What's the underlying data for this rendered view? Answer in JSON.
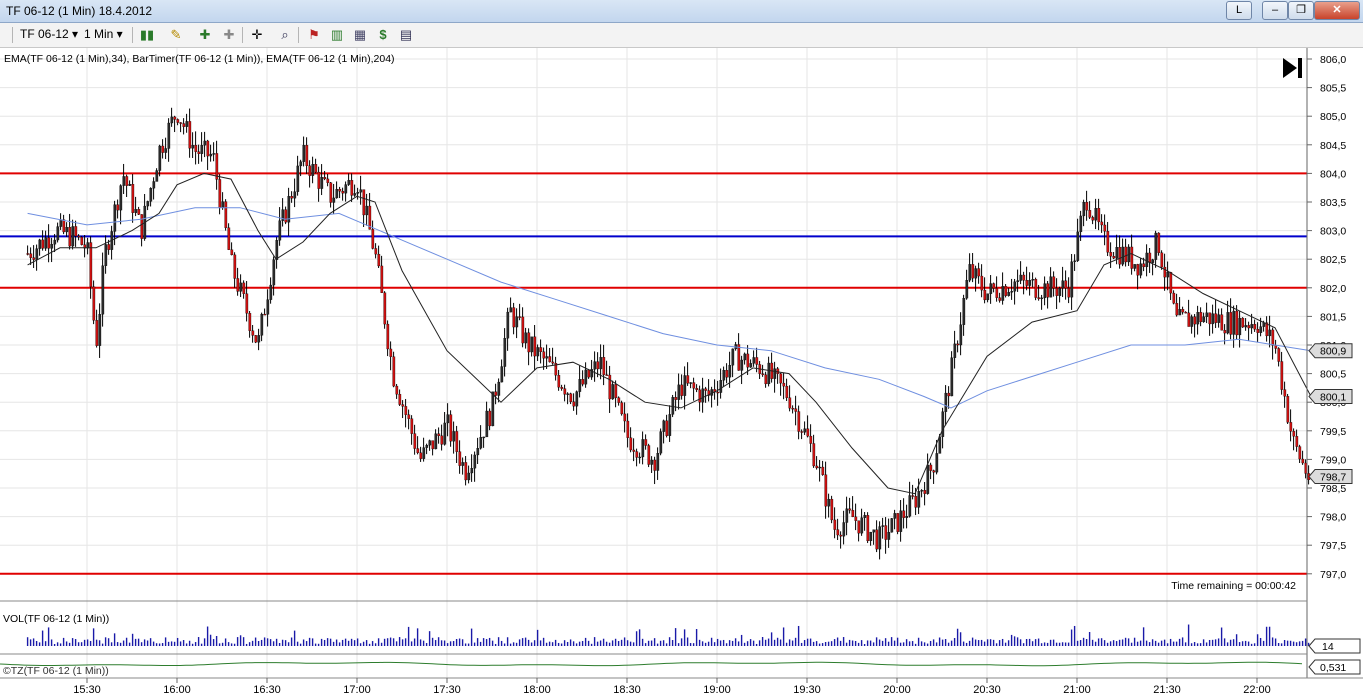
{
  "window": {
    "title": "TF 06-12 (1 Min)  18.4.2012",
    "layout_button": "L",
    "min_label": "–",
    "max_label": "❐",
    "close_label": "✕"
  },
  "toolbar": {
    "instrument": "TF 06-12",
    "interval": "1 Min",
    "icons": [
      "bar-type-icon",
      "drawing-pencil-icon",
      "zoom-in-icon",
      "zoom-out-icon",
      "crosshair-icon",
      "search-icon",
      "strategy-icon",
      "indicator-icon",
      "chart-template-icon",
      "dollar-icon",
      "properties-icon"
    ]
  },
  "indicators_label": "EMA(TF 06-12 (1 Min),34), BarTimer(TF 06-12 (1 Min)), EMA(TF 06-12 (1 Min),204)",
  "time_remaining": "Time remaining = 00:00:42",
  "price_axis_labels": [
    "806,0",
    "805,5",
    "805,0",
    "804,5",
    "804,0",
    "803,5",
    "803,0",
    "802,5",
    "802,0",
    "801,5",
    "801,0",
    "800,5",
    "800,0",
    "799,5",
    "799,0",
    "798,5",
    "798,0",
    "797,5",
    "797,0"
  ],
  "price_markers": [
    "800,9",
    "800,1",
    "798,7"
  ],
  "volume": {
    "label": "VOL(TF 06-12 (1 Min))",
    "marker": "14"
  },
  "lower_panel": {
    "label": "©TZ(TF 06-12 (1 Min))",
    "marker": "0,531"
  },
  "time_labels": [
    "15:30",
    "16:00",
    "16:30",
    "17:00",
    "17:30",
    "18:00",
    "18:30",
    "19:00",
    "19:30",
    "20:00",
    "20:30",
    "21:00",
    "21:30",
    "22:00"
  ],
  "chart_data": {
    "type": "candlestick",
    "yrange": [
      797.0,
      806.0
    ],
    "horizontal_lines": [
      {
        "price": 804.0,
        "color": "#e00000"
      },
      {
        "price": 802.9,
        "color": "#0000cc"
      },
      {
        "price": 802.0,
        "color": "#e00000"
      },
      {
        "price": 797.0,
        "color": "#e00000"
      }
    ],
    "close_path": [
      [
        15.17,
        802.6
      ],
      [
        15.33,
        803.0
      ],
      [
        15.42,
        802.9
      ],
      [
        15.5,
        802.7
      ],
      [
        15.55,
        801.0
      ],
      [
        15.6,
        802.6
      ],
      [
        15.7,
        804.0
      ],
      [
        15.8,
        803.0
      ],
      [
        15.9,
        804.4
      ],
      [
        16.0,
        805.1
      ],
      [
        16.1,
        804.4
      ],
      [
        16.2,
        804.3
      ],
      [
        16.3,
        802.4
      ],
      [
        16.45,
        801.0
      ],
      [
        16.55,
        802.8
      ],
      [
        16.7,
        804.3
      ],
      [
        16.85,
        803.6
      ],
      [
        17.0,
        803.9
      ],
      [
        17.1,
        802.6
      ],
      [
        17.2,
        800.5
      ],
      [
        17.35,
        799.0
      ],
      [
        17.5,
        799.6
      ],
      [
        17.6,
        798.8
      ],
      [
        17.75,
        799.9
      ],
      [
        17.85,
        801.6
      ],
      [
        17.95,
        801.0
      ],
      [
        18.05,
        800.7
      ],
      [
        18.2,
        800.1
      ],
      [
        18.35,
        800.7
      ],
      [
        18.5,
        799.4
      ],
      [
        18.65,
        799.0
      ],
      [
        18.8,
        800.3
      ],
      [
        18.95,
        800.1
      ],
      [
        19.1,
        800.8
      ],
      [
        19.25,
        800.6
      ],
      [
        19.4,
        800.1
      ],
      [
        19.55,
        799.0
      ],
      [
        19.65,
        797.8
      ],
      [
        19.75,
        798.0
      ],
      [
        19.9,
        797.6
      ],
      [
        20.0,
        797.9
      ],
      [
        20.1,
        798.3
      ],
      [
        20.2,
        798.9
      ],
      [
        20.3,
        800.5
      ],
      [
        20.4,
        802.3
      ],
      [
        20.5,
        801.9
      ],
      [
        20.65,
        802.1
      ],
      [
        20.8,
        802.0
      ],
      [
        20.95,
        802.0
      ],
      [
        21.05,
        803.6
      ],
      [
        21.15,
        802.8
      ],
      [
        21.25,
        802.6
      ],
      [
        21.35,
        802.4
      ],
      [
        21.45,
        802.8
      ],
      [
        21.55,
        801.4
      ],
      [
        21.7,
        801.5
      ],
      [
        21.85,
        801.4
      ],
      [
        22.0,
        801.4
      ],
      [
        22.1,
        801.0
      ],
      [
        22.2,
        799.3
      ],
      [
        22.3,
        798.6
      ]
    ],
    "ema34_path": [
      [
        15.17,
        802.4
      ],
      [
        15.35,
        802.7
      ],
      [
        15.55,
        802.7
      ],
      [
        15.75,
        803.0
      ],
      [
        15.9,
        803.3
      ],
      [
        16.0,
        803.8
      ],
      [
        16.15,
        804.0
      ],
      [
        16.3,
        803.9
      ],
      [
        16.45,
        803.0
      ],
      [
        16.55,
        802.5
      ],
      [
        16.7,
        802.8
      ],
      [
        16.85,
        803.3
      ],
      [
        17.0,
        803.6
      ],
      [
        17.1,
        803.5
      ],
      [
        17.25,
        802.3
      ],
      [
        17.5,
        800.9
      ],
      [
        17.8,
        800.0
      ],
      [
        18.0,
        800.6
      ],
      [
        18.2,
        800.7
      ],
      [
        18.4,
        800.4
      ],
      [
        18.6,
        800.0
      ],
      [
        18.8,
        799.9
      ],
      [
        19.0,
        800.2
      ],
      [
        19.2,
        800.6
      ],
      [
        19.4,
        800.5
      ],
      [
        19.55,
        800.0
      ],
      [
        19.75,
        799.2
      ],
      [
        19.95,
        798.5
      ],
      [
        20.1,
        798.4
      ],
      [
        20.25,
        799.5
      ],
      [
        20.5,
        800.8
      ],
      [
        20.75,
        801.4
      ],
      [
        21.0,
        801.6
      ],
      [
        21.15,
        802.4
      ],
      [
        21.3,
        802.6
      ],
      [
        21.5,
        802.3
      ],
      [
        21.7,
        801.9
      ],
      [
        21.9,
        801.6
      ],
      [
        22.1,
        801.3
      ],
      [
        22.3,
        800.1
      ]
    ],
    "ema204_path": [
      [
        15.17,
        803.3
      ],
      [
        15.5,
        803.1
      ],
      [
        15.8,
        803.2
      ],
      [
        16.1,
        803.4
      ],
      [
        16.35,
        803.4
      ],
      [
        16.6,
        803.2
      ],
      [
        16.9,
        803.3
      ],
      [
        17.2,
        802.9
      ],
      [
        17.5,
        802.5
      ],
      [
        17.8,
        802.1
      ],
      [
        18.1,
        801.8
      ],
      [
        18.4,
        801.5
      ],
      [
        18.7,
        801.2
      ],
      [
        19.0,
        801.0
      ],
      [
        19.3,
        800.9
      ],
      [
        19.6,
        800.6
      ],
      [
        19.9,
        800.4
      ],
      [
        20.15,
        800.1
      ],
      [
        20.3,
        799.9
      ],
      [
        20.5,
        800.2
      ],
      [
        20.8,
        800.5
      ],
      [
        21.0,
        800.7
      ],
      [
        21.3,
        801.0
      ],
      [
        21.6,
        801.0
      ],
      [
        21.9,
        801.1
      ],
      [
        22.3,
        800.9
      ]
    ]
  }
}
